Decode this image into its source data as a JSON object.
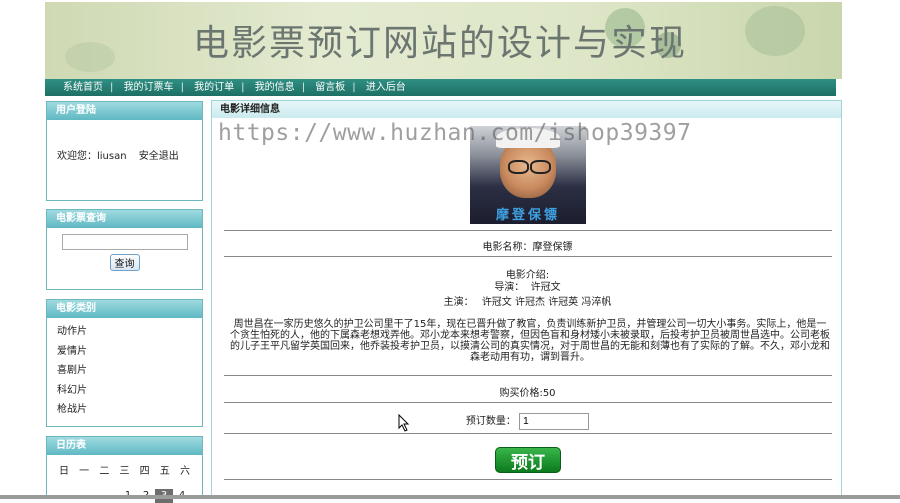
{
  "site": {
    "banner_title": "电影票预订网站的设计与实现"
  },
  "nav": [
    {
      "label": "系统首页"
    },
    {
      "label": "我的订票车"
    },
    {
      "label": "我的订单"
    },
    {
      "label": "我的信息"
    },
    {
      "label": "留言板"
    },
    {
      "label": "进入后台"
    }
  ],
  "login_panel": {
    "title": "用户登陆",
    "welcome": "欢迎您：liusan",
    "logout": "安全退出"
  },
  "search_panel": {
    "title": "电影票查询",
    "input_value": "",
    "button": "查询"
  },
  "category_panel": {
    "title": "电影类别",
    "items": [
      "动作片",
      "爱情片",
      "喜剧片",
      "科幻片",
      "枪战片"
    ]
  },
  "calendar_panel": {
    "title": "日历表",
    "weekdays": [
      "日",
      "一",
      "二",
      "三",
      "四",
      "五",
      "六"
    ],
    "dates": [
      "1",
      "2",
      "3",
      "4"
    ],
    "today": "3"
  },
  "main": {
    "title": "电影详细信息",
    "poster_title": "摩登保镖",
    "movie_name_line": "电影名称：摩登保镖",
    "intro_label": "电影介绍:",
    "director_line": "导演：  许冠文",
    "actors_label": "主演：",
    "actors": [
      "许冠文",
      "许冠杰",
      "许冠英",
      "冯淬帆"
    ],
    "synopsis": "周世昌在一家历史悠久的护卫公司里干了15年，现在已晋升做了教官，负责训练新护卫员，并管理公司一切大小事务。实际上，他是一个贪生怕死的人，他的下属森老想戏弄他。邓小龙本来想考警察，但因色盲和身材矮小未被录取，后投考护卫员被周世昌选中。公司老板的儿子王平凡留学英国回来，他乔装投考护卫员，以摸清公司的真实情况，对于周世昌的无能和刻薄也有了实际的了解。不久，邓小龙和森老动用有功，谓到晋升。",
    "price_line": "购买价格:50",
    "qty_label": "预订数量：",
    "qty_value": "1",
    "order_button": "预订"
  },
  "watermark": "https://www.huzhan.com/ishop39397",
  "colors": {
    "nav_bg": "#1e6f65",
    "panel_header": "#5fb8c3",
    "order_button": "#0b7a1d"
  }
}
